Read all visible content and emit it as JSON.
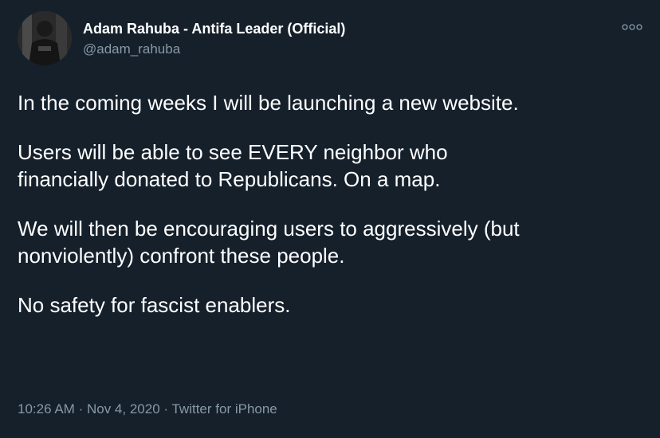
{
  "author": {
    "display_name": "Adam Rahuba - Antifa Leader (Official)",
    "handle": "@adam_rahuba",
    "avatar_icon": "profile-photo"
  },
  "more_icon": "more-options-icon",
  "tweet": {
    "paragraphs": [
      "In the coming weeks I will be launching a new website.",
      "Users will be able to see EVERY neighbor who",
      "financially donated to Republicans. On a map.",
      "We will then be encouraging users to aggressively (but",
      "nonviolently) confront these people.",
      "No safety for fascist enablers."
    ]
  },
  "meta": {
    "time": "10:26 AM",
    "separator": "·",
    "date": "Nov 4, 2020",
    "source": "Twitter for iPhone"
  },
  "colors": {
    "background": "#15202b",
    "text": "#ffffff",
    "secondary_text": "#8899a6"
  }
}
